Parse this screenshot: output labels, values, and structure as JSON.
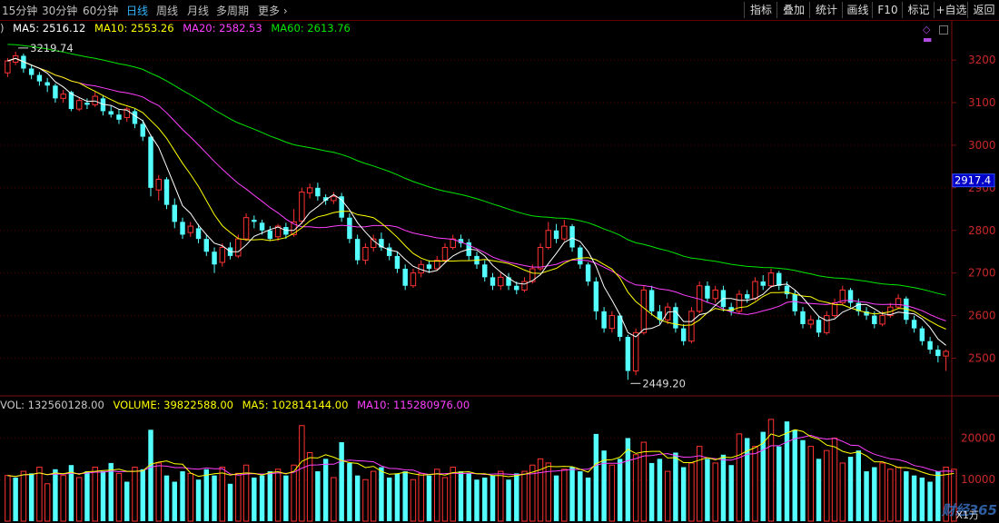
{
  "toolbar": {
    "periods": [
      {
        "label": "15分钟",
        "active": false
      },
      {
        "label": "30分钟",
        "active": false
      },
      {
        "label": "60分钟",
        "active": false
      },
      {
        "label": "日线",
        "active": true
      },
      {
        "label": "周线",
        "active": false
      },
      {
        "label": "月线",
        "active": false
      },
      {
        "label": "多周期",
        "active": false
      },
      {
        "label": "更多",
        "active": false
      }
    ],
    "right_buttons": [
      "指标",
      "叠加",
      "统计",
      "画线",
      "F10",
      "标记",
      "+自选",
      "返回"
    ]
  },
  "legend": {
    "prefix": ")",
    "ma5": "MA5: 2516.12",
    "ma10": "MA10: 2553.26",
    "ma20": "MA20: 2582.53",
    "ma60": "MA60: 2613.76"
  },
  "vol_legend": {
    "vol": "VOL: 132560128.00",
    "volume": "VOLUME: 39822588.00",
    "ma5": "MA5: 102814144.00",
    "ma10": "MA10: 115280976.00"
  },
  "colors": {
    "up": "#ff3232",
    "down": "#54ffff",
    "ma5": "#ffffff",
    "ma10": "#ffff00",
    "ma20": "#ff40ff",
    "ma60": "#00e600",
    "grid": "#5a0000",
    "axis_text": "#c82828"
  },
  "chart_data": {
    "type": "candlestick",
    "price_axis": {
      "ticks": [
        2500,
        2600,
        2700,
        2800,
        2900,
        3000,
        3100,
        3200
      ],
      "current_price": "2917.4",
      "range": [
        2420,
        3260
      ]
    },
    "volume_axis": {
      "ticks": [
        10000,
        20000
      ],
      "unit": "X1万",
      "range": [
        0,
        26000
      ]
    },
    "annotations": [
      {
        "label": "3219.74",
        "value": 3219.74,
        "type": "high"
      },
      {
        "label": "2449.20",
        "value": 2449.2,
        "type": "low"
      }
    ],
    "candles": [
      [
        3170,
        3198,
        3205,
        3160
      ],
      [
        3195,
        3210,
        3219.74,
        3188
      ],
      [
        3210,
        3180,
        3215,
        3170
      ],
      [
        3180,
        3165,
        3190,
        3155
      ],
      [
        3165,
        3150,
        3172,
        3140
      ],
      [
        3148,
        3140,
        3158,
        3125
      ],
      [
        3140,
        3110,
        3145,
        3100
      ],
      [
        3110,
        3120,
        3130,
        3100
      ],
      [
        3125,
        3085,
        3128,
        3080
      ],
      [
        3085,
        3105,
        3112,
        3080
      ],
      [
        3100,
        3095,
        3110,
        3085
      ],
      [
        3095,
        3115,
        3125,
        3090
      ],
      [
        3110,
        3080,
        3118,
        3070
      ],
      [
        3080,
        3072,
        3092,
        3065
      ],
      [
        3072,
        3060,
        3085,
        3050
      ],
      [
        3065,
        3085,
        3090,
        3055
      ],
      [
        3080,
        3050,
        3085,
        3040
      ],
      [
        3050,
        3020,
        3060,
        3010
      ],
      [
        3020,
        2900,
        3025,
        2880
      ],
      [
        2895,
        2920,
        2930,
        2870
      ],
      [
        2920,
        2860,
        2925,
        2850
      ],
      [
        2860,
        2820,
        2875,
        2805
      ],
      [
        2820,
        2790,
        2830,
        2780
      ],
      [
        2795,
        2810,
        2820,
        2785
      ],
      [
        2805,
        2780,
        2815,
        2770
      ],
      [
        2780,
        2750,
        2790,
        2740
      ],
      [
        2750,
        2720,
        2760,
        2700
      ],
      [
        2725,
        2760,
        2770,
        2715
      ],
      [
        2760,
        2740,
        2772,
        2732
      ],
      [
        2740,
        2780,
        2790,
        2735
      ],
      [
        2780,
        2830,
        2840,
        2775
      ],
      [
        2825,
        2820,
        2835,
        2805
      ],
      [
        2818,
        2800,
        2825,
        2790
      ],
      [
        2800,
        2780,
        2810,
        2775
      ],
      [
        2785,
        2810,
        2815,
        2775
      ],
      [
        2808,
        2790,
        2818,
        2780
      ],
      [
        2790,
        2820,
        2850,
        2785
      ],
      [
        2822,
        2890,
        2900,
        2815
      ],
      [
        2888,
        2900,
        2910,
        2875
      ],
      [
        2900,
        2880,
        2912,
        2870
      ],
      [
        2878,
        2870,
        2885,
        2860
      ],
      [
        2870,
        2880,
        2890,
        2862
      ],
      [
        2880,
        2830,
        2888,
        2820
      ],
      [
        2830,
        2780,
        2840,
        2770
      ],
      [
        2780,
        2730,
        2790,
        2720
      ],
      [
        2730,
        2760,
        2770,
        2720
      ],
      [
        2760,
        2780,
        2790,
        2750
      ],
      [
        2780,
        2760,
        2795,
        2752
      ],
      [
        2760,
        2740,
        2770,
        2730
      ],
      [
        2740,
        2710,
        2750,
        2700
      ],
      [
        2710,
        2670,
        2720,
        2660
      ],
      [
        2670,
        2700,
        2710,
        2665
      ],
      [
        2700,
        2720,
        2730,
        2690
      ],
      [
        2720,
        2710,
        2730,
        2700
      ],
      [
        2710,
        2730,
        2740,
        2705
      ],
      [
        2730,
        2760,
        2770,
        2725
      ],
      [
        2760,
        2780,
        2790,
        2755
      ],
      [
        2780,
        2770,
        2790,
        2760
      ],
      [
        2772,
        2740,
        2780,
        2730
      ],
      [
        2740,
        2720,
        2750,
        2710
      ],
      [
        2720,
        2690,
        2730,
        2680
      ],
      [
        2690,
        2670,
        2700,
        2660
      ],
      [
        2670,
        2690,
        2700,
        2660
      ],
      [
        2690,
        2670,
        2700,
        2660
      ],
      [
        2670,
        2660,
        2680,
        2650
      ],
      [
        2660,
        2680,
        2690,
        2655
      ],
      [
        2680,
        2710,
        2720,
        2675
      ],
      [
        2710,
        2760,
        2770,
        2705
      ],
      [
        2760,
        2800,
        2820,
        2755
      ],
      [
        2800,
        2780,
        2815,
        2770
      ],
      [
        2780,
        2810,
        2825,
        2775
      ],
      [
        2810,
        2760,
        2815,
        2750
      ],
      [
        2760,
        2720,
        2765,
        2710
      ],
      [
        2720,
        2680,
        2725,
        2670
      ],
      [
        2680,
        2610,
        2690,
        2590
      ],
      [
        2610,
        2570,
        2620,
        2560
      ],
      [
        2570,
        2600,
        2610,
        2560
      ],
      [
        2600,
        2550,
        2605,
        2540
      ],
      [
        2550,
        2470,
        2555,
        2449.2
      ],
      [
        2470,
        2560,
        2570,
        2460
      ],
      [
        2560,
        2660,
        2670,
        2555
      ],
      [
        2660,
        2610,
        2670,
        2600
      ],
      [
        2610,
        2590,
        2625,
        2580
      ],
      [
        2590,
        2620,
        2630,
        2580
      ],
      [
        2620,
        2570,
        2630,
        2560
      ],
      [
        2570,
        2540,
        2580,
        2530
      ],
      [
        2540,
        2610,
        2620,
        2535
      ],
      [
        2610,
        2670,
        2680,
        2605
      ],
      [
        2670,
        2640,
        2680,
        2630
      ],
      [
        2640,
        2660,
        2670,
        2630
      ],
      [
        2660,
        2620,
        2670,
        2610
      ],
      [
        2620,
        2610,
        2630,
        2600
      ],
      [
        2610,
        2650,
        2660,
        2605
      ],
      [
        2650,
        2640,
        2660,
        2630
      ],
      [
        2640,
        2680,
        2690,
        2635
      ],
      [
        2680,
        2670,
        2695,
        2660
      ],
      [
        2670,
        2700,
        2710,
        2665
      ],
      [
        2700,
        2670,
        2705,
        2660
      ],
      [
        2670,
        2650,
        2680,
        2640
      ],
      [
        2650,
        2610,
        2660,
        2600
      ],
      [
        2610,
        2580,
        2620,
        2570
      ],
      [
        2580,
        2590,
        2600,
        2570
      ],
      [
        2590,
        2560,
        2600,
        2550
      ],
      [
        2560,
        2600,
        2610,
        2555
      ],
      [
        2600,
        2630,
        2640,
        2595
      ],
      [
        2630,
        2660,
        2670,
        2625
      ],
      [
        2660,
        2630,
        2665,
        2620
      ],
      [
        2630,
        2610,
        2640,
        2600
      ],
      [
        2610,
        2600,
        2620,
        2590
      ],
      [
        2600,
        2580,
        2610,
        2570
      ],
      [
        2580,
        2600,
        2610,
        2575
      ],
      [
        2600,
        2620,
        2630,
        2595
      ],
      [
        2620,
        2640,
        2650,
        2615
      ],
      [
        2640,
        2590,
        2645,
        2580
      ],
      [
        2590,
        2570,
        2600,
        2560
      ],
      [
        2570,
        2540,
        2575,
        2530
      ],
      [
        2540,
        2520,
        2550,
        2510
      ],
      [
        2520,
        2505,
        2530,
        2490
      ],
      [
        2505,
        2516,
        2520,
        2470
      ]
    ],
    "volume": [
      11000,
      10500,
      12000,
      11500,
      13000,
      9000,
      12500,
      11000,
      13500,
      10500,
      12000,
      13000,
      12000,
      14000,
      11500,
      9500,
      13000,
      12500,
      22000,
      14000,
      11000,
      9500,
      12000,
      11500,
      10000,
      12500,
      11000,
      13000,
      9000,
      11500,
      13500,
      10500,
      11000,
      12000,
      12500,
      11000,
      13500,
      23000,
      16500,
      12000,
      15000,
      10500,
      19000,
      14000,
      11000,
      10000,
      12000,
      13000,
      10500,
      11500,
      12000,
      10000,
      11500,
      11000,
      12500,
      10500,
      13000,
      12000,
      11500,
      10000,
      10500,
      11000,
      12000,
      10000,
      11500,
      12000,
      13500,
      15000,
      14000,
      11000,
      12500,
      13000,
      12000,
      10500,
      21000,
      17000,
      13500,
      15000,
      20000,
      16000,
      19000,
      14000,
      15000,
      12000,
      16500,
      13000,
      14000,
      18000,
      15000,
      14000,
      16000,
      13500,
      21000,
      20000,
      18000,
      21500,
      24500,
      18000,
      24000,
      22000,
      19500,
      18000,
      15000,
      17000,
      20000,
      14000,
      15500,
      17000,
      12000,
      13000,
      14000,
      12500,
      13000,
      12000,
      11000,
      10500,
      9500,
      12000,
      13000,
      12500
    ],
    "volume_up": [
      true,
      false,
      true,
      false,
      true,
      true,
      false,
      true,
      false,
      true,
      false,
      true,
      false,
      false,
      true,
      false,
      true,
      false,
      false,
      true,
      false,
      false,
      false,
      true,
      false,
      false,
      false,
      true,
      false,
      true,
      true,
      false,
      false,
      false,
      true,
      false,
      true,
      true,
      true,
      false,
      false,
      true,
      false,
      false,
      false,
      true,
      true,
      false,
      false,
      false,
      false,
      true,
      true,
      false,
      true,
      true,
      true,
      false,
      false,
      false,
      false,
      false,
      true,
      false,
      false,
      true,
      true,
      true,
      true,
      false,
      true,
      false,
      false,
      false,
      false,
      false,
      true,
      false,
      false,
      true,
      true,
      false,
      false,
      true,
      false,
      false,
      true,
      true,
      false,
      true,
      false,
      false,
      true,
      false,
      true,
      false,
      true,
      false,
      false,
      false,
      false,
      true,
      false,
      true,
      true,
      true,
      false,
      false,
      false,
      false,
      true,
      true,
      true,
      false,
      false,
      false,
      false,
      false,
      true,
      true
    ]
  }
}
